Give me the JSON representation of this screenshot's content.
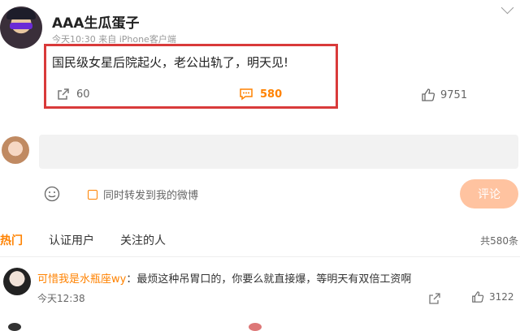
{
  "post": {
    "username": "AAA生瓜蛋子",
    "meta": "今天10:30 来自 iPhone客户端",
    "text": "国民级女星后院起火，老公出轨了，明天见!",
    "repost_count": "60",
    "comment_count": "580",
    "like_count": "9751"
  },
  "composer": {
    "sync_label": "同时转发到我的微博",
    "submit_label": "评论"
  },
  "tabs": {
    "items": [
      {
        "label": "热门"
      },
      {
        "label": "认证用户"
      },
      {
        "label": "关注的人"
      }
    ],
    "total": "共580条"
  },
  "comments": [
    {
      "user": "可惜我是水瓶座wy",
      "text": "：最烦这种吊胃口的，你要么就直接爆，等明天有双倍工资啊",
      "time": "今天12:38",
      "likes": "3122"
    }
  ],
  "colors": {
    "accent": "#ff8200",
    "highlight_box": "#d93a3a",
    "submit_bg": "#ffc3a0"
  },
  "icons": [
    "repost-icon",
    "comment-icon",
    "like-icon",
    "emoji-icon",
    "share-icon",
    "chevron-down-icon"
  ]
}
